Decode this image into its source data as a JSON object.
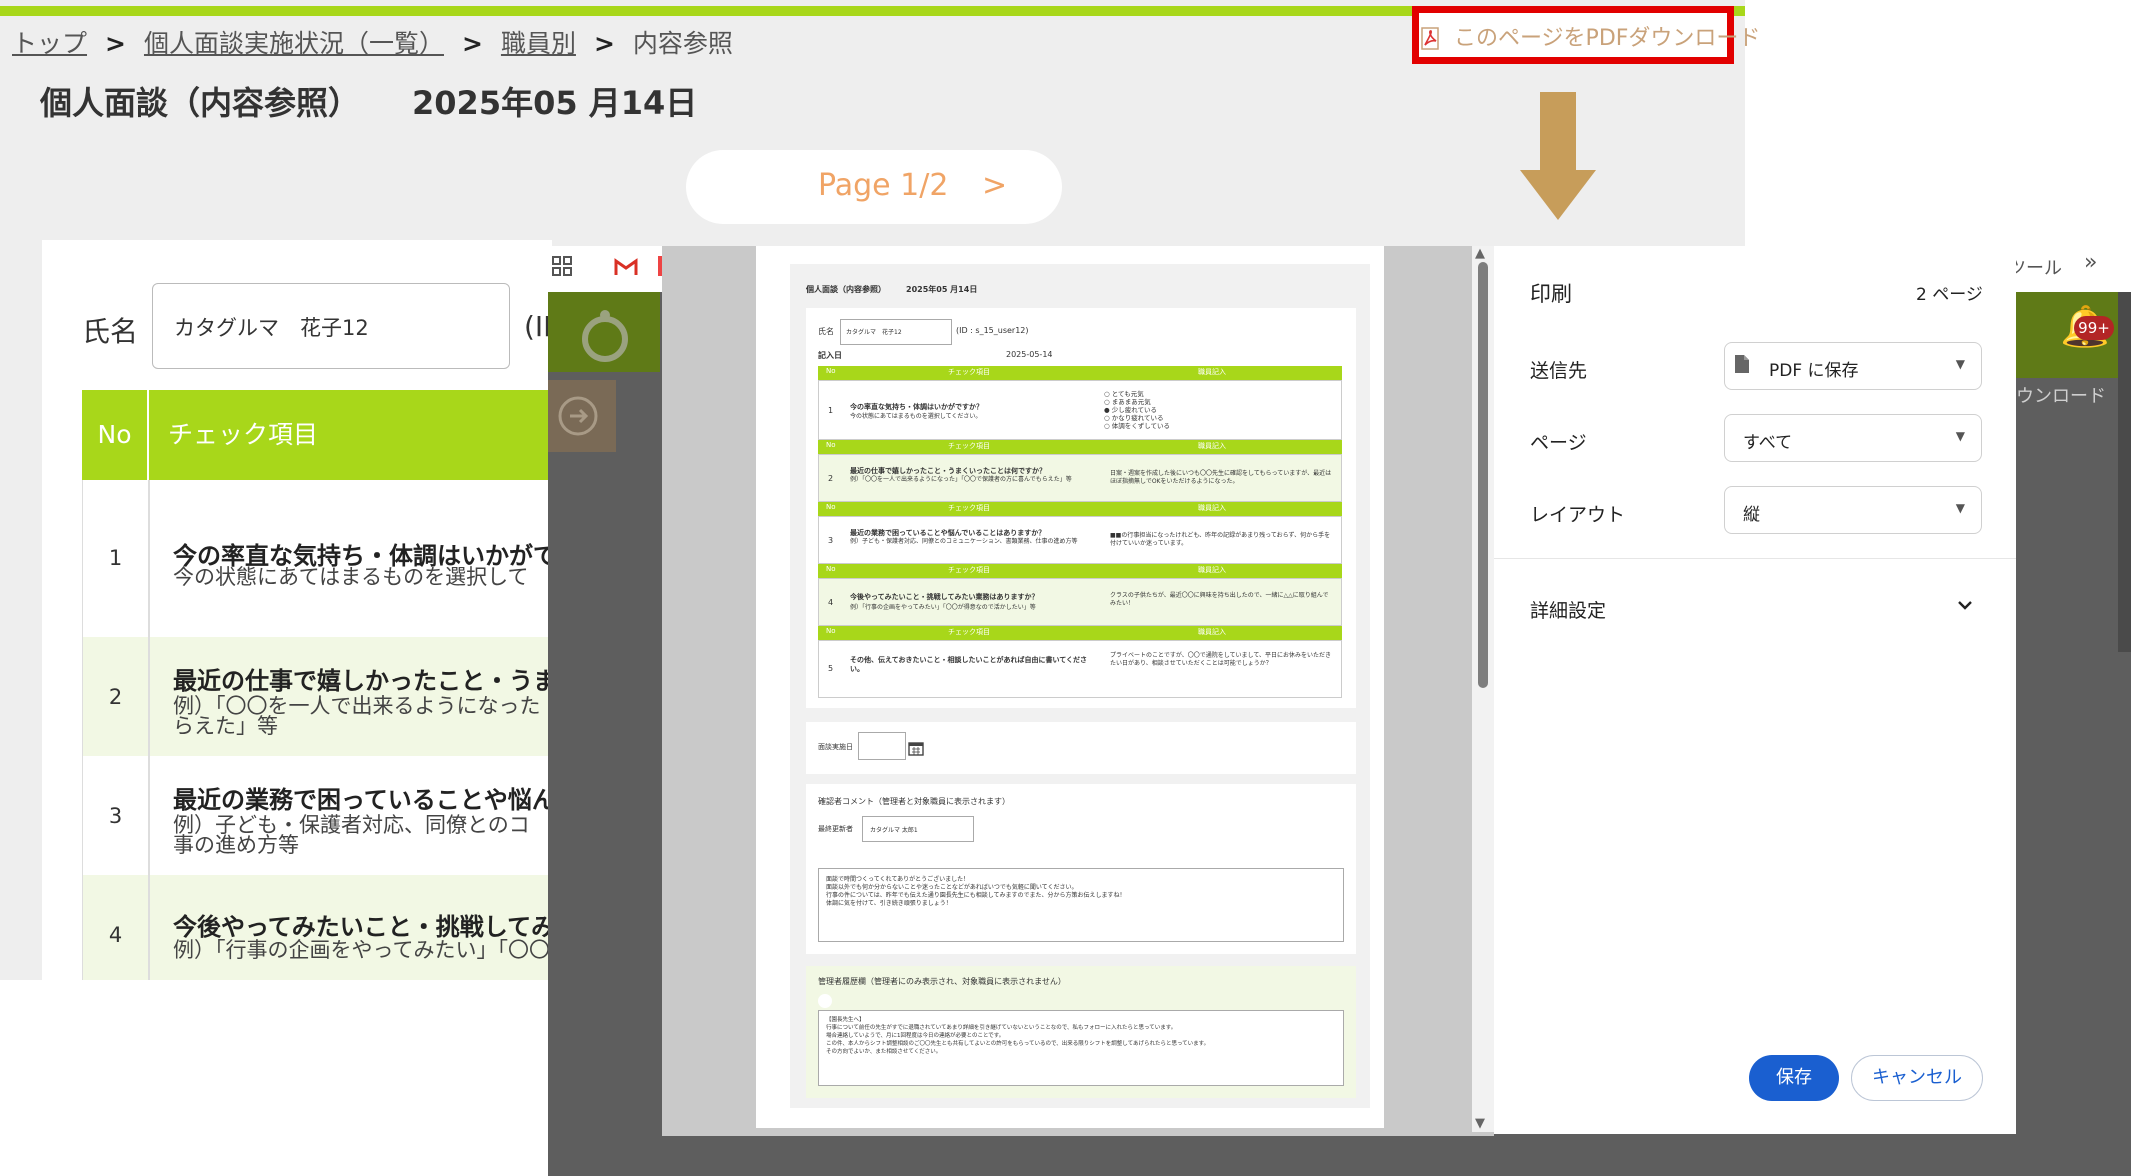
{
  "app": {
    "breadcrumb": [
      {
        "label": "トップ"
      },
      {
        "label": "個人面談実施状況（一覧）"
      },
      {
        "label": "職員別"
      },
      {
        "label": "内容参照"
      }
    ],
    "breadcrumb_sep": ">",
    "title": "個人面談（内容参照）",
    "title_date": "2025年05 月14日",
    "pdf_download_link": "このページをPDFダウンロード",
    "pager_label": "Page 1/2",
    "pager_next": ">",
    "name_label": "氏名",
    "name_value": "カタグルマ　花子12",
    "id_fragment": "(ID",
    "table_headers": {
      "no": "No",
      "check": "チェック項目"
    },
    "rows": [
      {
        "no": "1",
        "question": "今の率直な気持ち・体調はいかがで",
        "hint": "今の状態にあてはまるものを選択して"
      },
      {
        "no": "2",
        "question": "最近の仕事で嬉しかったこと・うま",
        "hint": "例）「〇〇を一人で出来るようになった",
        "hint2": "らえた」等"
      },
      {
        "no": "3",
        "question": "最近の業務で困っていることや悩ん",
        "hint": "例）子ども・保護者対応、同僚とのコ",
        "hint2": "事の進め方等"
      },
      {
        "no": "4",
        "question": "今後やってみたいこと・挑戦してみ",
        "hint": "例）「行事の企画をやってみたい」「〇〇"
      }
    ],
    "colors": {
      "accent": "#a8d71a",
      "highlight": "#e20000",
      "pager_text": "#f0a466"
    }
  },
  "browser": {
    "tools_text": "ツール",
    "more": "»",
    "badge": "99+",
    "download_fragment": "ウンロード"
  },
  "preview": {
    "title": "個人面談（内容参照）",
    "date": "2025年05 月14日",
    "name_label": "氏名",
    "name_value": "カタグルマ　花子12",
    "user_id": "(ID : s_15_user12)",
    "entry_label": "記入日",
    "entry_date": "2025-05-14",
    "hdr_no": "No",
    "hdr_check": "チェック項目",
    "hdr_staff": "職員記入",
    "q1": "今の率直な気持ち・体調はいかがですか？",
    "q1_hint": "今の状態にあてはまるものを選択してください。",
    "q1_options": [
      "とても元気",
      "まあまあ元気",
      "少し疲れている",
      "かなり疲れている",
      "体調をくずしている"
    ],
    "q2": "最近の仕事で嬉しかったこと・うまくいったことは何ですか？",
    "q2_hint": "例）「〇〇を一人で出来るようになった」「〇〇で保護者の方に喜んでもらえた」等",
    "q2_answer": "日案・週案を作成した後にいつも〇〇先生に確認をしてもらっていますが、最近はほぼ指摘無しでOKをいただけるようになった。",
    "q3": "最近の業務で困っていることや悩んでいることはありますか？",
    "q3_hint": "例）子ども・保護者対応、同僚とのコミュニケーション、書類業務、仕事の進め方等",
    "q3_answer": "■■の行事担当になったけれども、昨年の記録があまり残っておらず、何から手を付けていいか迷っています。",
    "q4": "今後やってみたいこと・挑戦してみたい業務はありますか？",
    "q4_hint": "例）「行事の企画をやってみたい」「〇〇が得意なので活かしたい」等",
    "q4_answer": "クラスの子供たちが、最近〇〇に興味を持ち出したので、一緒に△△に取り組んでみたい！",
    "q5": "その他、伝えておきたいこと・相談したいことがあれば自由に書いてください。",
    "q5_answer": "プライベートのことですが、〇〇で通院をしていまして、平日にお休みをいただきたい日があり、相談させていただくことは可能でしょうか？",
    "interview_date_label": "面談実施日",
    "comment_title": "確認者コメント（管理者と対象職員に表示されます）",
    "updater_label": "最終更新者",
    "updater_value": "カタグルマ 太郎1",
    "comment_lines": [
      "面談で時間つくってくれてありがとうございました！",
      "面談以外でも何か分からないことや迷ったことなどがあればいつでも気軽に聞いてください。",
      "行事の件については、昨年でも伝えた通り園長先生にも相談してみますのでまた、分から方策お伝えしますね！",
      "体調に気を付けて、引き続き頑張りましょう！"
    ],
    "admin_title": "管理者履歴欄（管理者にのみ表示され、対象職員に表示されません）",
    "admin_lines": [
      "【園長先生へ】",
      "行事について前任の先生がすでに退職されていてあまり詳細を引き継げていないということなので、私もフォローに入れたらと思っています。",
      "場合連絡していようで、月に1回程度は今日の連絡が必要とのことです。",
      "この件、本人からシフト調整相談のご〇〇先生とも共有してよいとの許可をもらっているので、出来る限りシフトを調整してあげられたらと思っています。",
      "その方向でよいか、また相談させてください。"
    ]
  },
  "print_panel": {
    "title": "印刷",
    "page_count": "2 ページ",
    "destination_label": "送信先",
    "destination_value": "PDF に保存",
    "pages_label": "ページ",
    "pages_value": "すべて",
    "layout_label": "レイアウト",
    "layout_value": "縦",
    "more_settings": "詳細設定",
    "save": "保存",
    "cancel": "キャンセル"
  }
}
